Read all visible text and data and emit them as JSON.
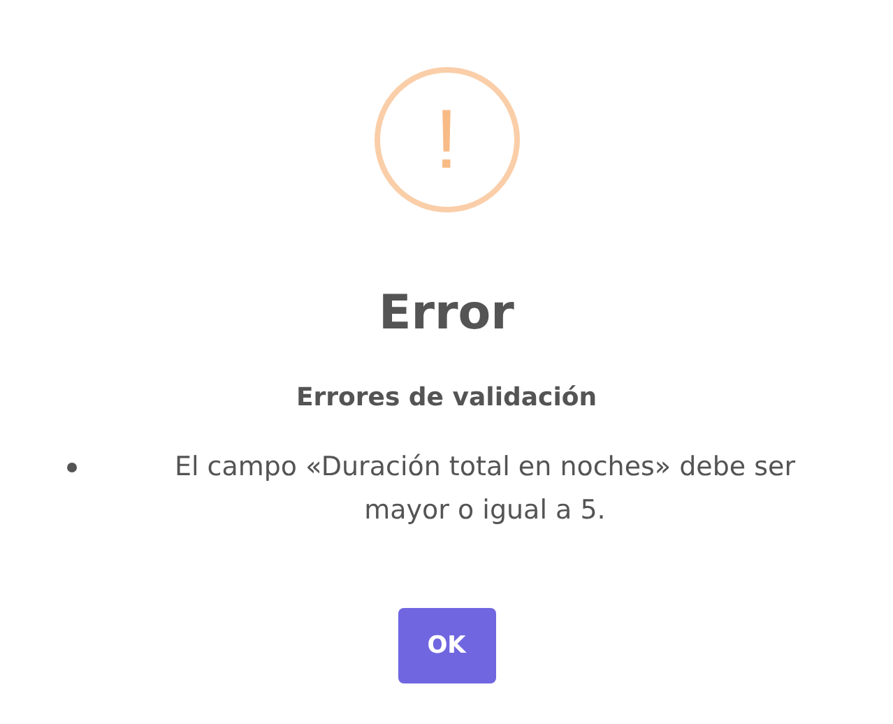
{
  "dialog": {
    "icon": {
      "kind": "warning",
      "glyph": "!"
    },
    "title": "Error",
    "subtitle": "Errores de validación",
    "errors": [
      "El campo «Duración total en noches» debe ser mayor o igual a 5."
    ],
    "buttons": [
      {
        "label": "OK",
        "kind": "confirm"
      }
    ]
  }
}
